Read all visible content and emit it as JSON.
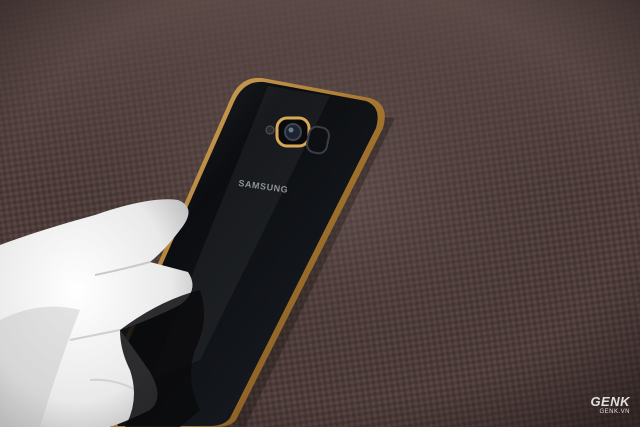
{
  "photo": {
    "phone_brand_label": "SAMSUNG",
    "watermark": {
      "main": "GENK",
      "sub": "GENK.VN"
    },
    "colors": {
      "background_fabric": "#4a3a38",
      "phone_body": "#0d0f12",
      "gold_frame": "#b8893f",
      "glove": "#f2f2f2"
    }
  }
}
